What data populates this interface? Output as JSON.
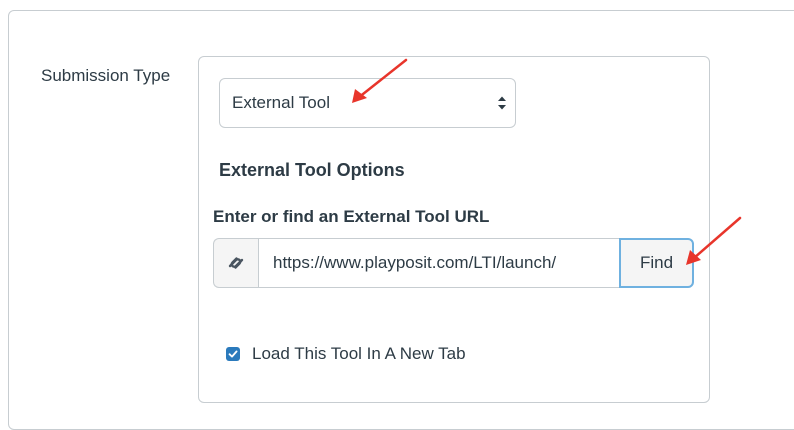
{
  "form": {
    "row_label": "Submission Type",
    "submission_type": {
      "selected": "External Tool"
    },
    "external_tool": {
      "section_title": "External Tool Options",
      "url_label": "Enter or find an External Tool URL",
      "url_value": "https://www.playposit.com/LTI/launch/",
      "find_label": "Find",
      "new_tab_label": "Load This Tool In A New Tab",
      "new_tab_checked": true
    }
  },
  "icons": {
    "link": "link-icon",
    "select_arrows": "updown-chevron-icon",
    "checkmark": "checkmark-icon"
  },
  "colors": {
    "text": "#2d3b45",
    "border": "#c7cdd1",
    "checkbox_fill": "#2b7abc",
    "find_focus_border": "#6fb1e0",
    "annotation_arrow": "#e8352b"
  }
}
